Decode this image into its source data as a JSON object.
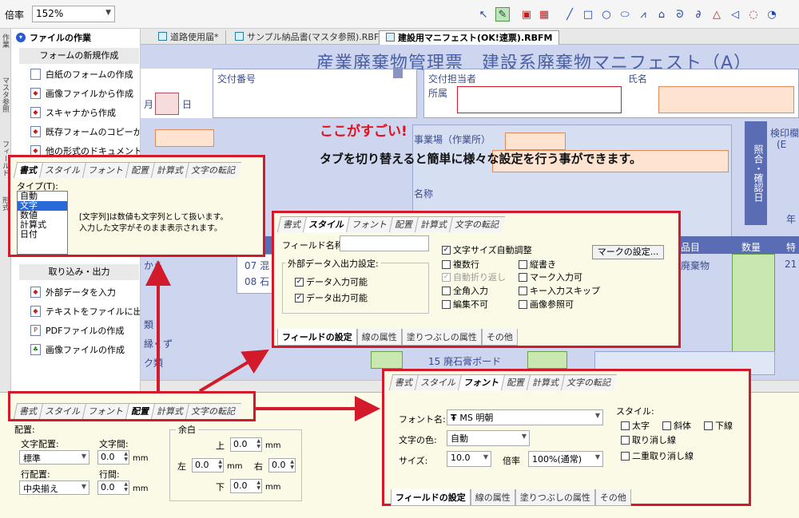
{
  "toolbar": {
    "zoom_label": "倍率",
    "zoom_value": "152%",
    "tools": [
      "pointer-icon",
      "field-edit-icon",
      "insert-field-icon",
      "table-icon",
      "line-icon",
      "rectangle-icon",
      "ellipse-icon",
      "rounded-icon",
      "polyline-icon",
      "polygon-icon",
      "curve-icon",
      "freeform-icon",
      "triangle-icon",
      "hexagon-icon",
      "arc-icon",
      "pie-icon"
    ]
  },
  "vstrip": {
    "tabs": [
      "作業",
      "マスタ参照",
      "フィールド",
      "形式"
    ]
  },
  "taskpane": {
    "section_file": "ファイルの作業",
    "sub_new": "フォームの新規作成",
    "items_new": [
      "白紙のフォームの作成",
      "画像ファイルから作成",
      "スキャナから作成",
      "既存フォームのコピーか",
      "他の形式のドキュメント"
    ],
    "sub_import": "取り込み・出力",
    "items_import": [
      "外部データを入力",
      "テキストをファイルに出",
      "PDFファイルの作成",
      "画像ファイルの作成"
    ]
  },
  "doctabs": [
    "道路使用届*",
    "サンプル納品書(マスタ参照).RBFM",
    "建設用マニフェスト(OK!速票).RBFM"
  ],
  "form": {
    "title": "産業廃棄物管理票　建設系廃棄物マニフェスト（A）",
    "labels": {
      "koufu_bango": "交付番号",
      "koufu_tantou": "交付担当者",
      "shozoku": "所属",
      "shimei": "氏名",
      "jigyoujou": "事業場（作業所）",
      "meishou": "名称",
      "hinmoku": "品目",
      "suuryou": "数量",
      "tsuki": "月",
      "hi": "日",
      "row_07": "07 混",
      "row_08": "08 石",
      "row_15": "15 廃石膏ボード",
      "hai_label": "業廃棄物",
      "kara": "から",
      "kuzu": "縁くず",
      "ku_sen": "ク類",
      "shou": "類",
      "num21": "21",
      "kensa": "検印欄",
      "kensa2": "(E",
      "nen": "年"
    },
    "vert_label": "照合・確認日"
  },
  "banner": {
    "title": "ここがすごい!",
    "text": "タブを切り替えると簡単に様々な設定を行う事ができます。"
  },
  "top_tabs": [
    "書式",
    "スタイル",
    "フォント",
    "配置",
    "計算式",
    "文字の転記"
  ],
  "bottom_tabs": [
    "フィールドの設定",
    "線の属性",
    "塗りつぶしの属性",
    "その他"
  ],
  "format_panel": {
    "type_label": "タイプ(T):",
    "types": [
      "自動",
      "文字",
      "数値",
      "計算式",
      "日付"
    ],
    "selected_type": "文字",
    "description_line1": "[文字列]は数値も文字列として扱います。",
    "description_line2": "入力した文字がそのまま表示されます。"
  },
  "style_panel": {
    "field_name_label": "フィールド名称:",
    "field_name_value": "",
    "ext_group_title": "外部データ入出力設定:",
    "ext_input": "データ入力可能",
    "ext_output": "データ出力可能",
    "auto_font": "文字サイズ自動調整",
    "checks": [
      {
        "label": "複数行",
        "checked": false,
        "disabled": false
      },
      {
        "label": "縦書き",
        "checked": false,
        "disabled": false
      },
      {
        "label": "自動折り返し",
        "checked": true,
        "disabled": true
      },
      {
        "label": "マーク入力可",
        "checked": false,
        "disabled": false
      },
      {
        "label": "全角入力",
        "checked": false,
        "disabled": false
      },
      {
        "label": "キー入力スキップ",
        "checked": false,
        "disabled": false
      },
      {
        "label": "編集不可",
        "checked": false,
        "disabled": false
      },
      {
        "label": "画像参照可",
        "checked": false,
        "disabled": false
      }
    ],
    "mark_button": "マークの設定..."
  },
  "font_panel": {
    "font_name_label": "フォント名:",
    "font_name_value": "MS 明朝",
    "font_color_label": "文字の色:",
    "font_color_value": "自動",
    "size_label": "サイズ:",
    "size_value": "10.0",
    "scale_label": "倍率",
    "scale_value": "100%(通常)",
    "style_group": "スタイル:",
    "styles": [
      "太字",
      "斜体",
      "下線",
      "取り消し線",
      "二重取り消し線"
    ]
  },
  "layout_panel": {
    "haichi_group": "配置:",
    "moji_haichi_label": "文字配置:",
    "moji_haichi_value": "標準",
    "moji_kan_label": "文字間:",
    "moji_kan_value": "0.0",
    "gyou_haichi_label": "行配置:",
    "gyou_haichi_value": "中央揃え",
    "gyou_kan_label": "行間:",
    "gyou_kan_value": "0.0",
    "yohaku_group": "余白",
    "top_label": "上",
    "left_label": "左",
    "right_label": "右",
    "bottom_label": "下",
    "margin_value": "0.0",
    "unit": "mm"
  },
  "colors": {
    "callout_red": "#d31a2a",
    "banner_red": "#e0101e",
    "panel_bg": "#fbfae6",
    "form_bg": "#cdd6ee"
  }
}
